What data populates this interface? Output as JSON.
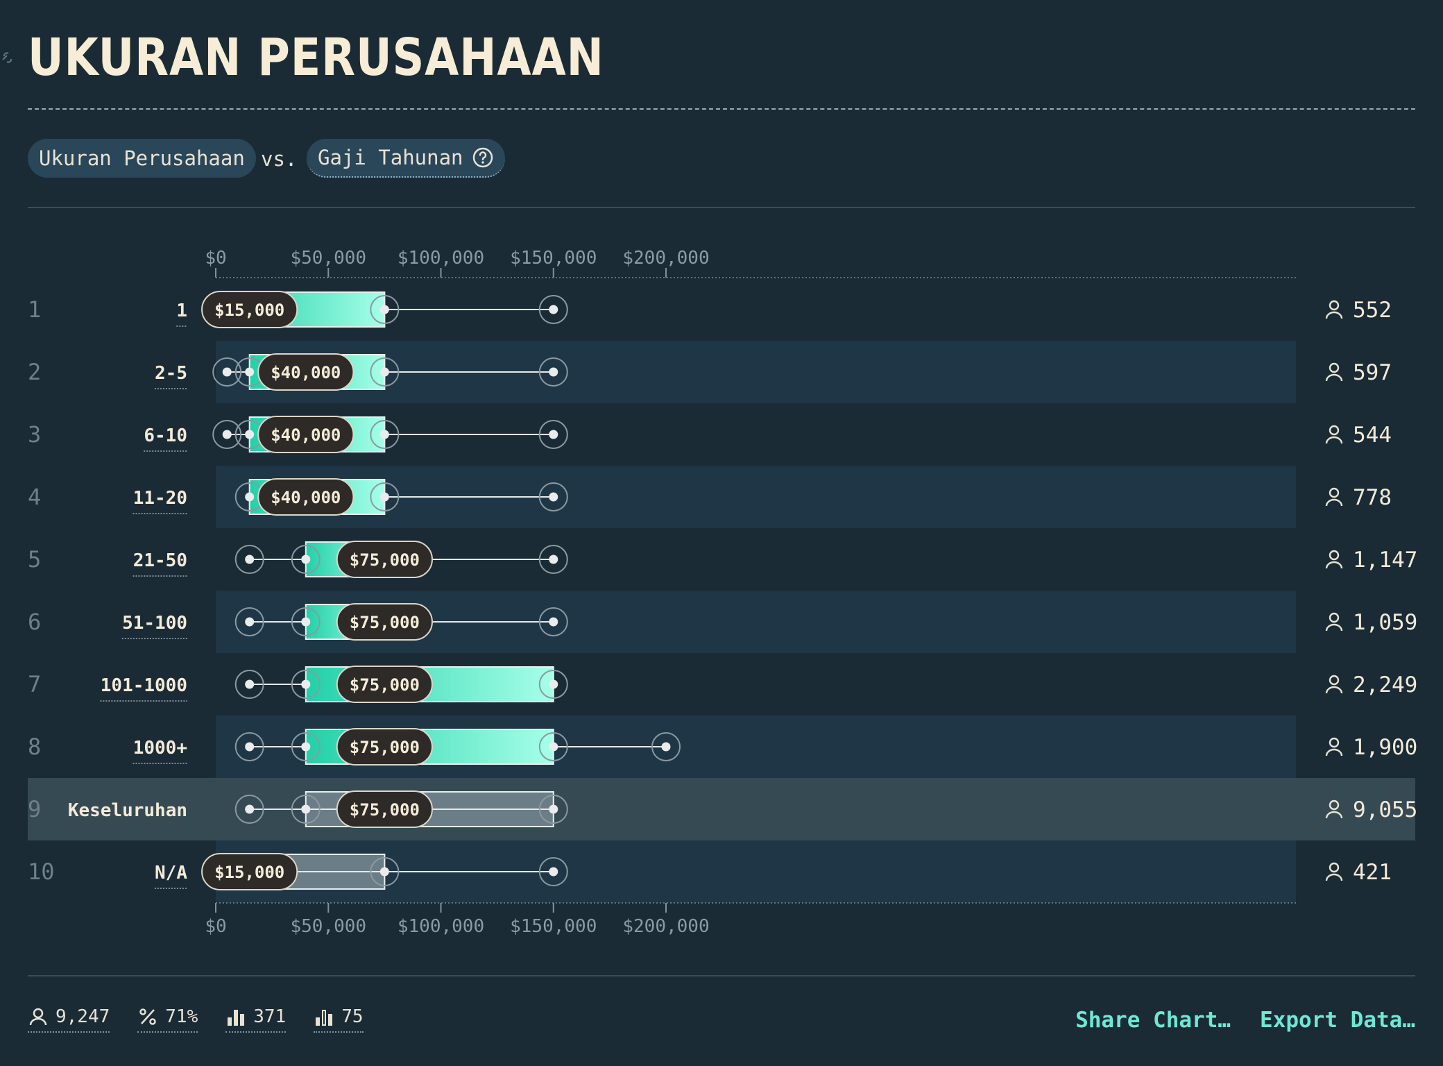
{
  "header": {
    "title": "UKURAN PERUSAHAAN"
  },
  "controls": {
    "dimension": "Ukuran Perusahaan",
    "vs": "vs.",
    "metric": "Gaji Tahunan"
  },
  "footer": {
    "stats": [
      {
        "icon": "person-icon",
        "value": "9,247"
      },
      {
        "icon": "percent-icon",
        "value": "71%"
      },
      {
        "icon": "bar-chart-icon",
        "value": "371"
      },
      {
        "icon": "bar-chart-outline-icon",
        "value": "75"
      }
    ],
    "share_label": "Share Chart…",
    "export_label": "Export Data…"
  },
  "colors": {
    "background": "#1a2b35",
    "band": "#1f3646",
    "highlight_band": "#364a53",
    "bar_start": "#22d0a8",
    "bar_end": "#a6ffe8",
    "accent": "#6ee8d4"
  },
  "chart_data": {
    "type": "range_bar",
    "x_ticks": [
      "$0",
      "$50,000",
      "$100,000",
      "$150,000",
      "$200,000"
    ],
    "xlim": [
      0,
      240000
    ],
    "rows": [
      {
        "rank": "1",
        "label": "1",
        "min": 5000,
        "p25": 5000,
        "median": 15000,
        "p75": 75000,
        "max": 150000,
        "median_label": "$15,000",
        "count": "552",
        "style": "normal"
      },
      {
        "rank": "2",
        "label": "2-5",
        "min": 5000,
        "p25": 15000,
        "median": 40000,
        "p75": 75000,
        "max": 150000,
        "median_label": "$40,000",
        "count": "597",
        "style": "normal"
      },
      {
        "rank": "3",
        "label": "6-10",
        "min": 5000,
        "p25": 15000,
        "median": 40000,
        "p75": 75000,
        "max": 150000,
        "median_label": "$40,000",
        "count": "544",
        "style": "normal"
      },
      {
        "rank": "4",
        "label": "11-20",
        "min": 15000,
        "p25": 15000,
        "median": 40000,
        "p75": 75000,
        "max": 150000,
        "median_label": "$40,000",
        "count": "778",
        "style": "normal"
      },
      {
        "rank": "5",
        "label": "21-50",
        "min": 15000,
        "p25": 40000,
        "median": 75000,
        "p75": 75000,
        "max": 150000,
        "median_label": "$75,000",
        "count": "1,147",
        "style": "normal"
      },
      {
        "rank": "6",
        "label": "51-100",
        "min": 15000,
        "p25": 40000,
        "median": 75000,
        "p75": 75000,
        "max": 150000,
        "median_label": "$75,000",
        "count": "1,059",
        "style": "normal"
      },
      {
        "rank": "7",
        "label": "101-1000",
        "min": 15000,
        "p25": 40000,
        "median": 75000,
        "p75": 150000,
        "max": 150000,
        "median_label": "$75,000",
        "count": "2,249",
        "style": "normal"
      },
      {
        "rank": "8",
        "label": "1000+",
        "min": 15000,
        "p25": 40000,
        "median": 75000,
        "p75": 150000,
        "max": 200000,
        "median_label": "$75,000",
        "count": "1,900",
        "style": "normal"
      },
      {
        "rank": "9",
        "label": "Keseluruhan",
        "min": 15000,
        "p25": 40000,
        "median": 75000,
        "p75": 150000,
        "max": 150000,
        "median_label": "$75,000",
        "count": "9,055",
        "style": "overall"
      },
      {
        "rank": "10",
        "label": "N/A",
        "min": 5000,
        "p25": 5000,
        "median": 15000,
        "p75": 75000,
        "max": 150000,
        "median_label": "$15,000",
        "count": "421",
        "style": "muted"
      }
    ]
  }
}
